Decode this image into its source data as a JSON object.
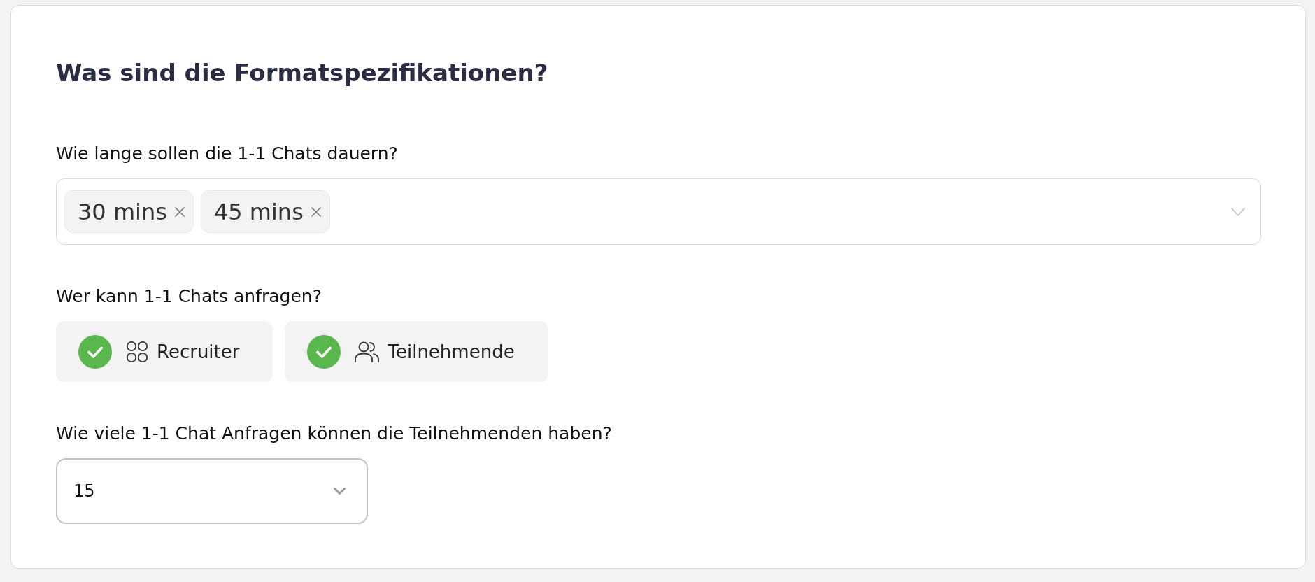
{
  "title": "Was sind die Formatspezifikationen?",
  "questions": [
    {
      "kind": "multiselect",
      "label": "Wie lange sollen die 1-1 Chats dauern?",
      "tags": [
        "30 mins",
        "45 mins"
      ]
    },
    {
      "kind": "choices",
      "label": "Wer kann 1-1 Chats anfragen?",
      "options": [
        {
          "kind": "recruiter",
          "label": "Recruiter",
          "checked": true
        },
        {
          "kind": "participant",
          "label": "Teilnehmende",
          "checked": true
        }
      ]
    },
    {
      "kind": "select",
      "label": "Wie viele 1-1 Chat Anfragen können die Teilnehmenden haben?",
      "value": "15"
    }
  ]
}
